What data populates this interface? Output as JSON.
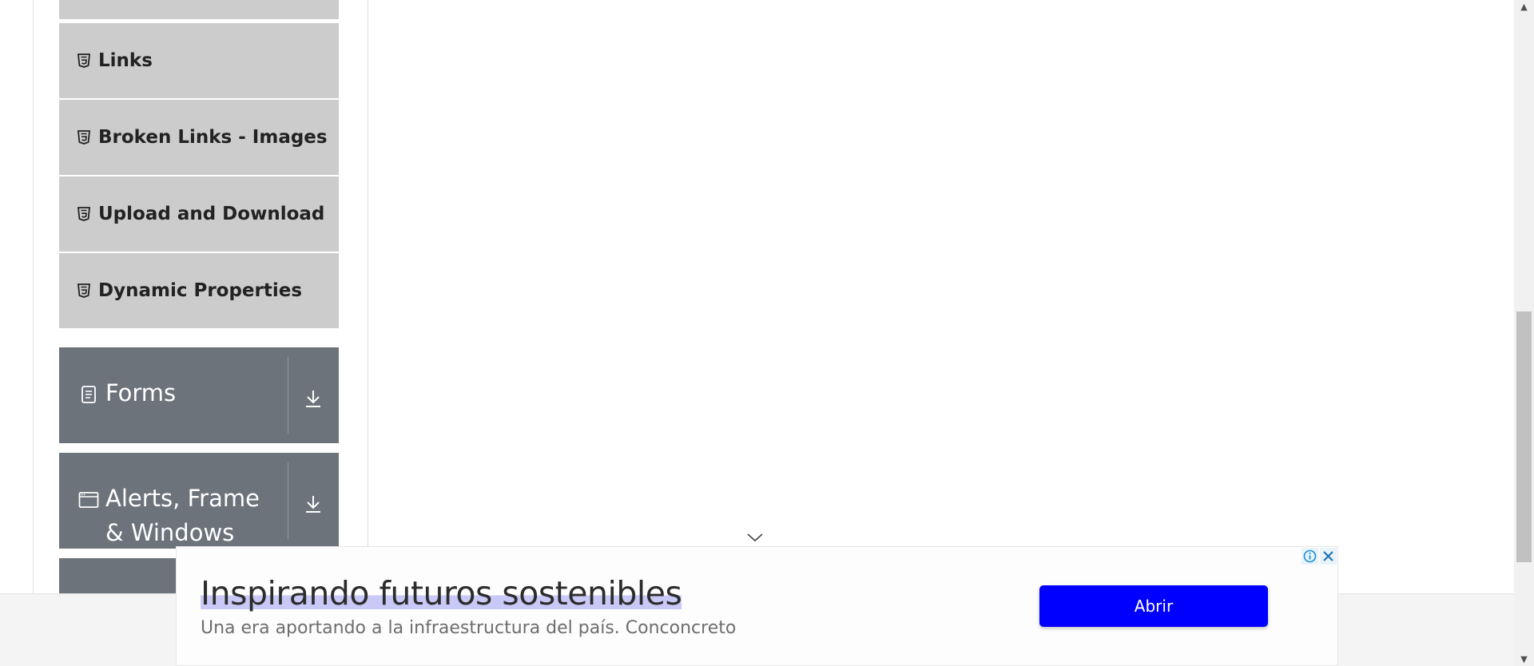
{
  "sidebar": {
    "items": [
      {
        "label": "",
        "icon": "html5-icon"
      },
      {
        "label": "Links",
        "icon": "html5-icon"
      },
      {
        "label": "Broken Links - Images",
        "icon": "html5-icon"
      },
      {
        "label": "Upload and Download",
        "icon": "html5-icon"
      },
      {
        "label": "Dynamic Properties",
        "icon": "html5-icon"
      }
    ],
    "groups": [
      {
        "label": "Forms",
        "icon": "document-icon",
        "toggle_icon": "download-arrow-icon"
      },
      {
        "label": "Alerts, Frame & Windows",
        "icon": "window-icon",
        "toggle_icon": "download-arrow-icon"
      },
      {
        "label": "",
        "icon": "",
        "toggle_icon": ""
      }
    ]
  },
  "ad": {
    "collapse_icon": "chevron-down-icon",
    "headline": "Inspirando futuros sostenibles",
    "description": "Una era aportando a la infraestructura del país. Conconcreto",
    "button_label": "Abrir",
    "info_icon": "info-icon",
    "close_icon": "close-icon",
    "button_color": "#0000ff"
  },
  "colors": {
    "menu_item_bg": "#cccccc",
    "group_header_bg": "#6c737a"
  }
}
